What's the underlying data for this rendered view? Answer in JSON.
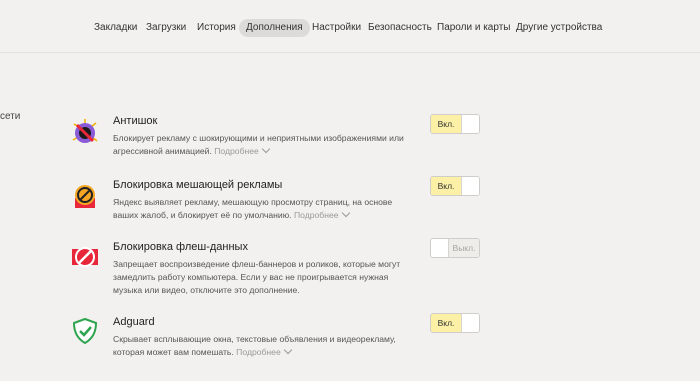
{
  "nav": {
    "items": [
      {
        "label": "Закладки"
      },
      {
        "label": "Загрузки"
      },
      {
        "label": "История"
      },
      {
        "label": "Дополнения"
      },
      {
        "label": "Настройки"
      },
      {
        "label": "Безопасность"
      },
      {
        "label": "Пароли и карты"
      },
      {
        "label": "Другие устройства"
      }
    ],
    "active": "Дополнения"
  },
  "side_fragment": "сети",
  "extensions": [
    {
      "title": "Антишок",
      "desc": "Блокирует рекламу с шокирующими и неприятными изображениями или агрессивной анимацией.",
      "more": "Подробнее",
      "toggle": "Вкл.",
      "enabled": true,
      "icon": "antishock-icon"
    },
    {
      "title": "Блокировка мешающей рекламы",
      "desc": "Яндекс выявляет рекламу, мешающую просмотру страниц, на основе ваших жалоб, и блокирует её по умолчанию.",
      "more": "Подробнее",
      "toggle": "Вкл.",
      "enabled": true,
      "icon": "ad-block-icon"
    },
    {
      "title": "Блокировка флеш-данных",
      "desc": "Запрещает воспроизведение флеш-баннеров и роликов, которые могут замедлить работу компьютера. Если у вас не проигрывается нужная музыка или видео, отключите это дополнение.",
      "more": "",
      "toggle": "Выкл.",
      "enabled": false,
      "icon": "flash-block-icon"
    },
    {
      "title": "Adguard",
      "desc": "Скрывает всплывающие окна, текстовые объявления и видеорекламу, которая может вам помешать.",
      "more": "Подробнее",
      "toggle": "Вкл.",
      "enabled": true,
      "icon": "adguard-shield-icon"
    }
  ],
  "colors": {
    "toggle_on": "#fcefa6",
    "background": "#f2f1f0",
    "adguard_green": "#2ea44f",
    "flash_red": "#e8283a"
  }
}
